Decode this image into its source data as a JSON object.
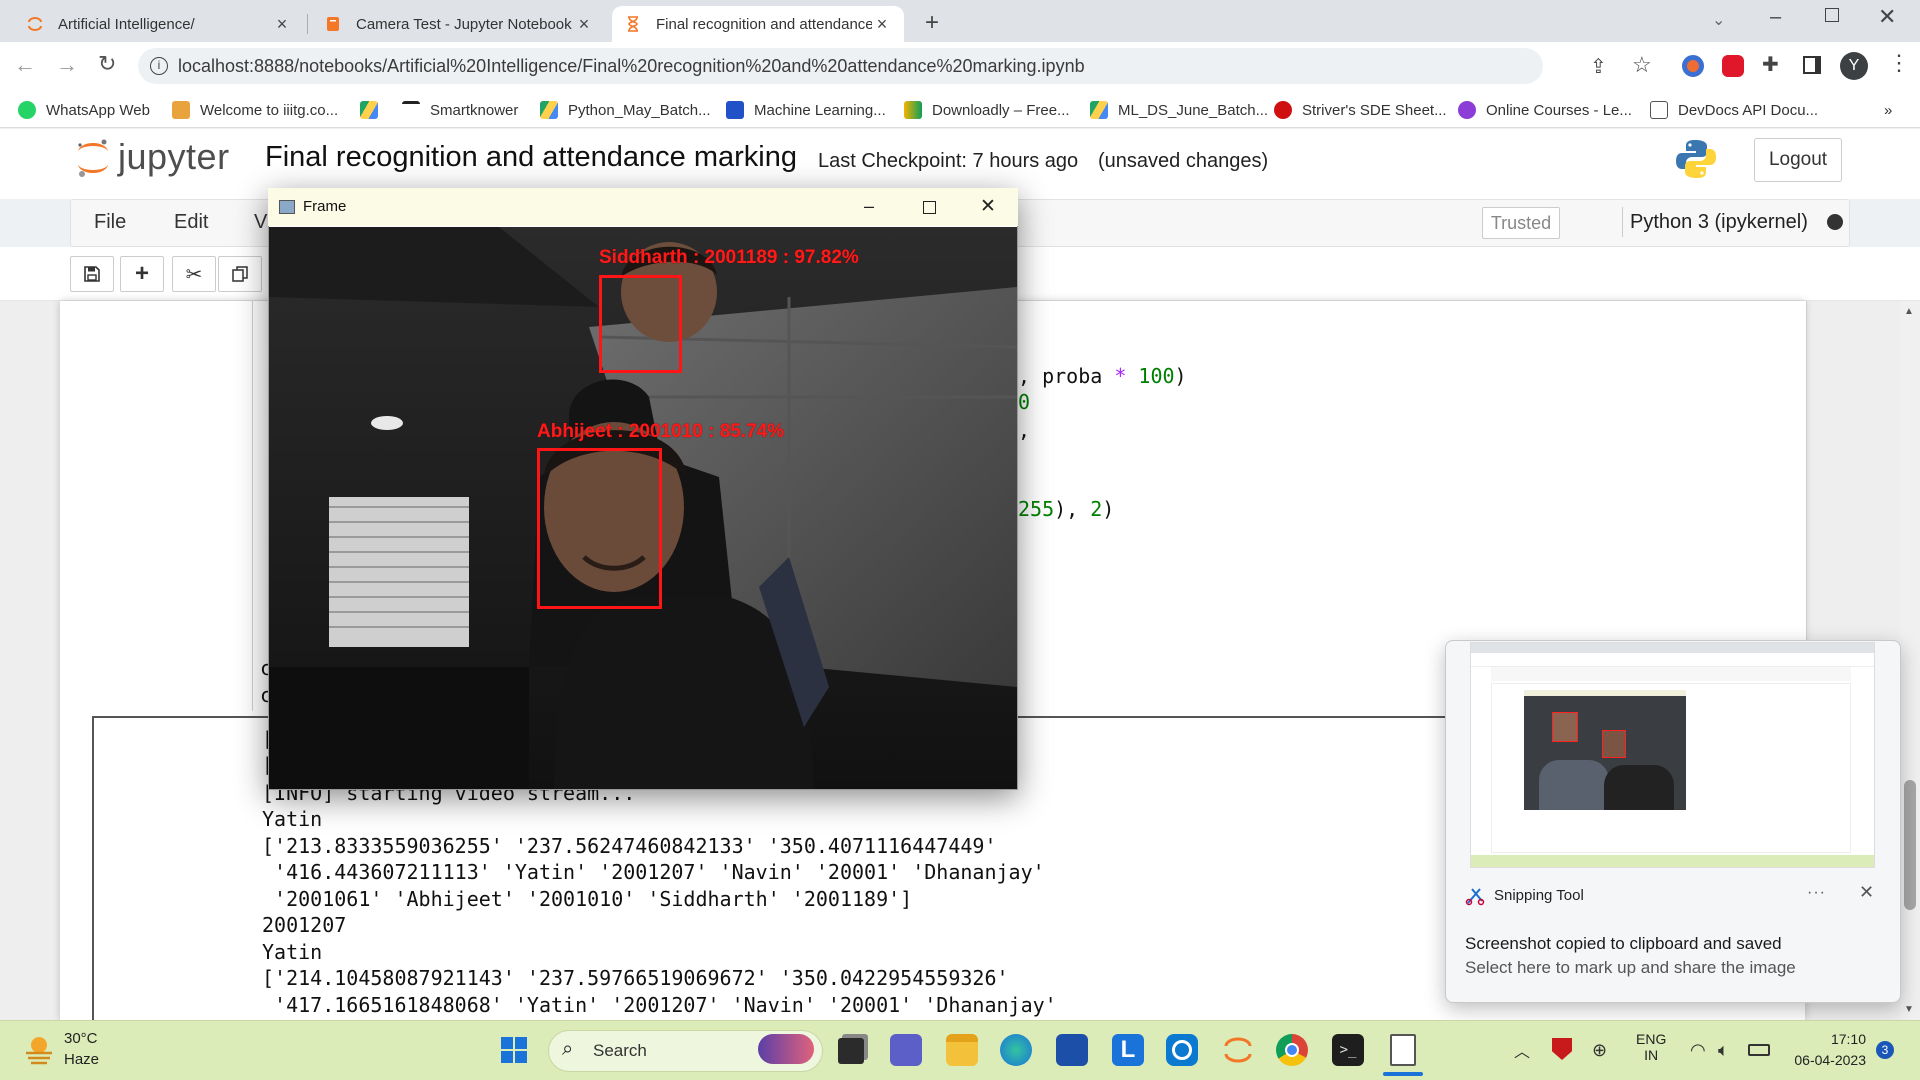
{
  "browser": {
    "tabs": [
      {
        "label": "Artificial Intelligence/",
        "active": false
      },
      {
        "label": "Camera Test - Jupyter Notebook",
        "active": false
      },
      {
        "label": "Final recognition and attendance",
        "active": true
      }
    ],
    "url": "localhost:8888/notebooks/Artificial%20Intelligence/Final%20recognition%20and%20attendance%20marking.ipynb",
    "bookmarks": [
      "WhatsApp Web",
      "Welcome to iiitg.co...",
      "Smartknower",
      "Python_May_Batch...",
      "Machine Learning...",
      "Downloadly – Free...",
      "ML_DS_June_Batch...",
      "Striver's SDE Sheet...",
      "Online Courses - Le...",
      "DevDocs API Docu..."
    ],
    "more_bookmarks": "»",
    "profile_initial": "Y"
  },
  "jupyter": {
    "logo_text": "jupyter",
    "notebook_title": "Final recognition and attendance marking",
    "checkpoint": "Last Checkpoint: 7 hours ago",
    "unsaved": "(unsaved changes)",
    "logout": "Logout",
    "menus": [
      "File",
      "Edit",
      "V"
    ],
    "trusted": "Trusted",
    "kernel": "Python 3 (ipykernel)"
  },
  "code_visible": {
    "line1_a": ", proba ",
    "line1_op": "*",
    "line1_num": "100",
    "line1_b": ")",
    "line2_num": "0",
    "line3": ",",
    "line4_num_a": "255",
    "line4_mid": "), ",
    "line4_num_b": "2",
    "line4_end": ")"
  },
  "output_lines": [
    "[",
    "[",
    "[INFO] starting video stream...",
    "Yatin",
    "['213.8333559036255' '237.56247460842133' '350.4071116447449'",
    " '416.443607211113' 'Yatin' '2001207' 'Navin' '20001' 'Dhananjay'",
    " '2001061' 'Abhijeet' '2001010' 'Siddharth' '2001189']",
    "2001207",
    "Yatin",
    "['214.10458087921143' '237.59766519069672' '350.0422954559326'",
    " '417.1665161848068' 'Yatin' '2001207' 'Navin' '20001' 'Dhananjay'"
  ],
  "left_chars": [
    "c",
    "c"
  ],
  "frame_window": {
    "title": "Frame",
    "faces": [
      {
        "label": "Siddharth : 2001189 : 97.82%"
      },
      {
        "label": "Abhijeet : 2001010 : 85.74%"
      }
    ]
  },
  "notification": {
    "app": "Snipping Tool",
    "title": "Screenshot copied to clipboard and saved",
    "body": "Select here to mark up and share the image",
    "more": "···"
  },
  "taskbar": {
    "weather_temp": "30°C",
    "weather_desc": "Haze",
    "search": "Search",
    "lang_1": "ENG",
    "lang_2": "IN",
    "time": "17:10",
    "date": "06-04-2023",
    "notif_count": "3"
  },
  "colors": {
    "taskbar": "#dcecb8",
    "face_box": "#ff1515",
    "jupyter_orange": "#f37726",
    "code_green": "#008000",
    "code_purple": "#aa22ff"
  }
}
